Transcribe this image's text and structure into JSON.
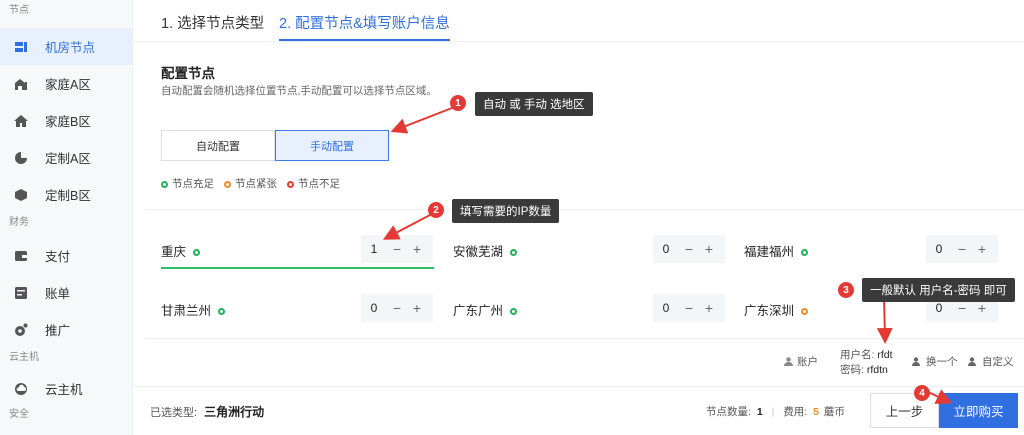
{
  "sidebar": {
    "sections": [
      "节点",
      "财务",
      "云主机",
      "安全"
    ],
    "items": [
      {
        "label": "机房节点",
        "icon": "server-room-icon",
        "active": true
      },
      {
        "label": "家庭A区",
        "icon": "home-building-icon"
      },
      {
        "label": "家庭B区",
        "icon": "house-icon"
      },
      {
        "label": "定制A区",
        "icon": "pie-icon"
      },
      {
        "label": "定制B区",
        "icon": "cube-icon"
      },
      {
        "label": "支付",
        "icon": "wallet-icon"
      },
      {
        "label": "账单",
        "icon": "bill-icon"
      },
      {
        "label": "推广",
        "icon": "promote-icon"
      },
      {
        "label": "云主机",
        "icon": "cloud-icon"
      }
    ]
  },
  "tabs": [
    {
      "label": "1. 选择节点类型"
    },
    {
      "label": "2. 配置节点&填写账户信息",
      "active": true
    }
  ],
  "config": {
    "title": "配置节点",
    "description": "自动配置会随机选择位置节点,手动配置可以选择节点区域。",
    "auto_label": "自动配置",
    "manual_label": "手动配置"
  },
  "legend": [
    {
      "label": "节点充足",
      "color": "#1fb25a"
    },
    {
      "label": "节点紧张",
      "color": "#f08b1f"
    },
    {
      "label": "节点不足",
      "color": "#e53935"
    }
  ],
  "nodes": [
    {
      "name": "重庆",
      "value": "1",
      "status": "green"
    },
    {
      "name": "安徽芜湖",
      "value": "0",
      "status": "green"
    },
    {
      "name": "福建福州",
      "value": "0",
      "status": "green"
    },
    {
      "name": "甘肃兰州",
      "value": "0",
      "status": "green"
    },
    {
      "name": "广东广州",
      "value": "0",
      "status": "green"
    },
    {
      "name": "广东深圳",
      "value": "0",
      "status": "orange"
    }
  ],
  "account": {
    "label": "账户",
    "username_label": "用户名:",
    "username": "rfdt",
    "password_label": "密码:",
    "password": "rfdtn",
    "change_label": "换一个",
    "custom_label": "自定义"
  },
  "footer": {
    "selected_type_label": "已选类型:",
    "selected_type": "三角洲行动",
    "node_count_label": "节点数量:",
    "node_count": "1",
    "fee_label": "费用:",
    "fee_value": "5",
    "fee_unit": "蘑币",
    "prev_label": "上一步",
    "buy_label": "立即购买"
  },
  "annotations": [
    {
      "num": "1",
      "text": "自动 或 手动 选地区"
    },
    {
      "num": "2",
      "text": "填写需要的IP数量"
    },
    {
      "num": "3",
      "text": "一般默认 用户名-密码 即可"
    },
    {
      "num": "4"
    }
  ],
  "colors": {
    "accent": "#2f6fe0",
    "annotation": "#e53935"
  }
}
